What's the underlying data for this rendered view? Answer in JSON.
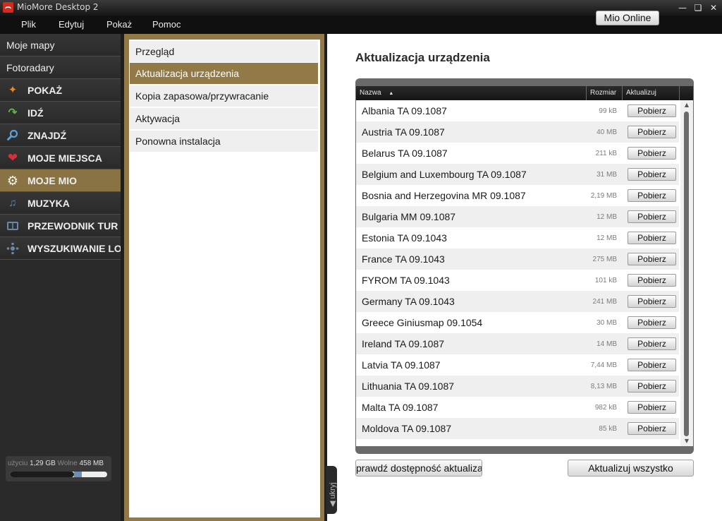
{
  "window": {
    "title": "MioMore Desktop 2",
    "controls": [
      "minimize",
      "maximize",
      "close"
    ]
  },
  "menu": [
    "Plik",
    "Edytuj",
    "Pokaż",
    "Pomoc"
  ],
  "mio_online_label": "Mio Online",
  "sidebar": {
    "items": [
      {
        "label": "Moje mapy",
        "icon": null,
        "style": "plain"
      },
      {
        "label": "Fotoradary",
        "icon": null,
        "style": "plain"
      },
      {
        "label": "POKAŻ",
        "icon": "sparkle-icon",
        "style": "big"
      },
      {
        "label": "IDŹ",
        "icon": "turn-arrow-icon",
        "style": "big"
      },
      {
        "label": "ZNAJDŹ",
        "icon": "magnifier-icon",
        "style": "big"
      },
      {
        "label": "MOJE MIEJSCA",
        "icon": "heart-icon",
        "style": "big"
      },
      {
        "label": "MOJE MIO",
        "icon": "gear-icon",
        "style": "big",
        "active": true
      },
      {
        "label": "MUZYKA",
        "icon": "music-note-icon",
        "style": "big"
      },
      {
        "label": "PRZEWODNIK TUR",
        "icon": "book-icon",
        "style": "big"
      },
      {
        "label": "WYSZUKIWANIE LO",
        "icon": "target-icon",
        "style": "big"
      }
    ],
    "storage": {
      "used_label": "użyciu",
      "used_value": "1,29 GB",
      "free_label": "Wolne",
      "free_value": "458 MB",
      "used_fraction": 0.66,
      "pending_fraction": 0.08
    }
  },
  "submenu": [
    {
      "label": "Przegląd"
    },
    {
      "label": "Aktualizacja urządzenia",
      "active": true
    },
    {
      "label": "Kopia zapasowa/przywracanie"
    },
    {
      "label": "Aktywacja"
    },
    {
      "label": "Ponowna instalacja"
    }
  ],
  "hide_tab_label": "ukryj",
  "content": {
    "title": "Aktualizacja urządzenia",
    "columns": {
      "name": "Nazwa",
      "size": "Rozmiar",
      "update": "Aktualizuj"
    },
    "download_label": "Pobierz",
    "rows": [
      {
        "name": "Albania TA 09.1087",
        "size": "99 kB"
      },
      {
        "name": "Austria TA 09.1087",
        "size": "40 MB"
      },
      {
        "name": "Belarus TA 09.1087",
        "size": "211 kB"
      },
      {
        "name": "Belgium and Luxembourg TA 09.1087",
        "size": "31 MB"
      },
      {
        "name": "Bosnia and Herzegovina MR 09.1087",
        "size": "2,19 MB"
      },
      {
        "name": "Bulgaria MM 09.1087",
        "size": "12 MB"
      },
      {
        "name": "Estonia TA 09.1043",
        "size": "12 MB"
      },
      {
        "name": "France TA 09.1043",
        "size": "275 MB"
      },
      {
        "name": "FYROM TA 09.1043",
        "size": "101 kB"
      },
      {
        "name": "Germany TA 09.1043",
        "size": "241 MB"
      },
      {
        "name": "Greece Giniusmap 09.1054",
        "size": "30 MB"
      },
      {
        "name": "Ireland TA 09.1087",
        "size": "14 MB"
      },
      {
        "name": "Latvia TA 09.1087",
        "size": "7,44 MB"
      },
      {
        "name": "Lithuania TA 09.1087",
        "size": "8,13 MB"
      },
      {
        "name": "Malta TA 09.1087",
        "size": "982 kB"
      },
      {
        "name": "Moldova TA 09.1087",
        "size": "85 kB"
      }
    ],
    "check_button": "prawdź dostępność aktualizac",
    "update_all_button": "Aktualizuj wszystko"
  }
}
